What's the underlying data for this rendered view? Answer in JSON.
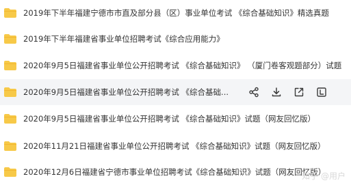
{
  "files": [
    {
      "name": "2019年下半年福建宁德市市直及部分县（区）事业单位考试 《综合基础知识》精选真题"
    },
    {
      "name": "2019年下半年福建省事业单位招聘考试《综合应用能力》"
    },
    {
      "name": "2020年9月5日福建省事业单位公开招聘考试 《综合基础知识》 （厦门卷客观题部分）试题"
    },
    {
      "name": "2020年9月5日福建省事业单位公开招聘考试 《综合基础..."
    },
    {
      "name": "2020年9月5日福建省事业单位公开招聘考试 《综合基础知识》试题（网友回忆版）"
    },
    {
      "name": "2020年11月21日福建省事业单位公开招聘考试 《综合基础知识》试题（网友回忆版）"
    },
    {
      "name": "2020年12月6日福建省宁德市事业单位招聘考试《综合基础知识》试题（网友回忆版）"
    }
  ],
  "hover_actions": [
    {
      "icon": "share-icon"
    },
    {
      "icon": "download-icon"
    },
    {
      "icon": "open-external-icon"
    },
    {
      "icon": "text-preview-icon"
    }
  ],
  "colors": {
    "folder": "#f7c948",
    "folder_tab": "#f2b630",
    "hover_row": "#f4f5f7",
    "icon": "#3a3a3a"
  },
  "watermark": "知乎 @用户"
}
